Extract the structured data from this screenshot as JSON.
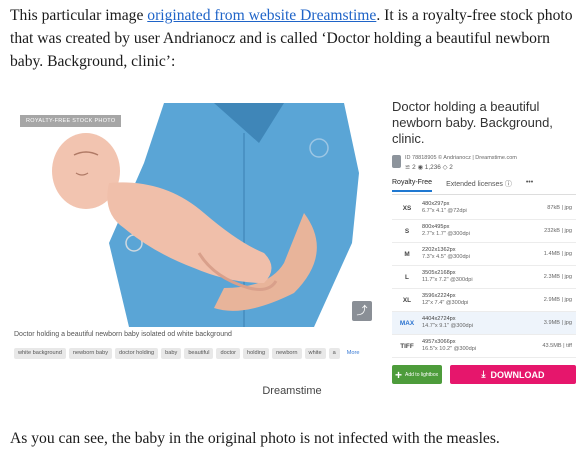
{
  "article": {
    "intro_pre": "This particular image ",
    "intro_link": "originated from website Dreamstime",
    "intro_post": ". It is a royalty-free stock photo that was created by user Andrianocz and is called ‘Doctor holding a beautiful newborn baby. Background, clinic’:",
    "figure_credit": "Dreamstime",
    "outro": "As you can see, the baby in the original photo is not infected with the measles."
  },
  "screenshot": {
    "badge": "ROYALTY-FREE STOCK PHOTO",
    "caption": "Doctor holding a beautiful newborn baby isolated od white background",
    "tags": [
      "white background",
      "newborn baby",
      "doctor holding",
      "baby",
      "beautiful",
      "doctor",
      "holding",
      "newborn",
      "white",
      "a"
    ],
    "more_label": "More",
    "title": "Doctor holding a beautiful newborn baby. Background, clinic.",
    "meta_line": "ID 78818905 © Andrianocz | Dreamstime.com",
    "stats": "≌ 2  ◉ 1,236  ◇ 2",
    "tabs": [
      "Royalty-Free",
      "Extended licenses ⓘ",
      "•••"
    ],
    "sizes": [
      {
        "code": "XS",
        "px": "480x297px",
        "in": "6.7\"x 4.1\" @72dpi",
        "file": "87kB | jpg"
      },
      {
        "code": "S",
        "px": "800x495px",
        "in": "2.7\"x 1.7\" @300dpi",
        "file": "232kB | jpg"
      },
      {
        "code": "M",
        "px": "2202x1362px",
        "in": "7.3\"x 4.5\" @300dpi",
        "file": "1.4MB | jpg"
      },
      {
        "code": "L",
        "px": "3505x2168px",
        "in": "11.7\"x 7.2\" @300dpi",
        "file": "2.3MB | jpg"
      },
      {
        "code": "XL",
        "px": "3596x2224px",
        "in": "12\"x 7.4\" @300dpi",
        "file": "2.9MB | jpg"
      },
      {
        "code": "MAX",
        "px": "4404x2724px",
        "in": "14.7\"x 9.1\" @300dpi",
        "file": "3.9MB | jpg"
      },
      {
        "code": "TIFF",
        "px": "4957x3066px",
        "in": "16.5\"x 10.2\" @300dpi",
        "file": "43.5MB | tiff"
      }
    ],
    "lightbox_label": "Add to lightbox",
    "download_label": "DOWNLOAD"
  },
  "colors": {
    "link": "#1f64c8",
    "download": "#e6166c",
    "lightbox": "#4d9c3b",
    "scrubs": "#5aa5d6"
  },
  "icons": [
    "share-icon",
    "user-icon",
    "download-icon",
    "plus-icon"
  ]
}
